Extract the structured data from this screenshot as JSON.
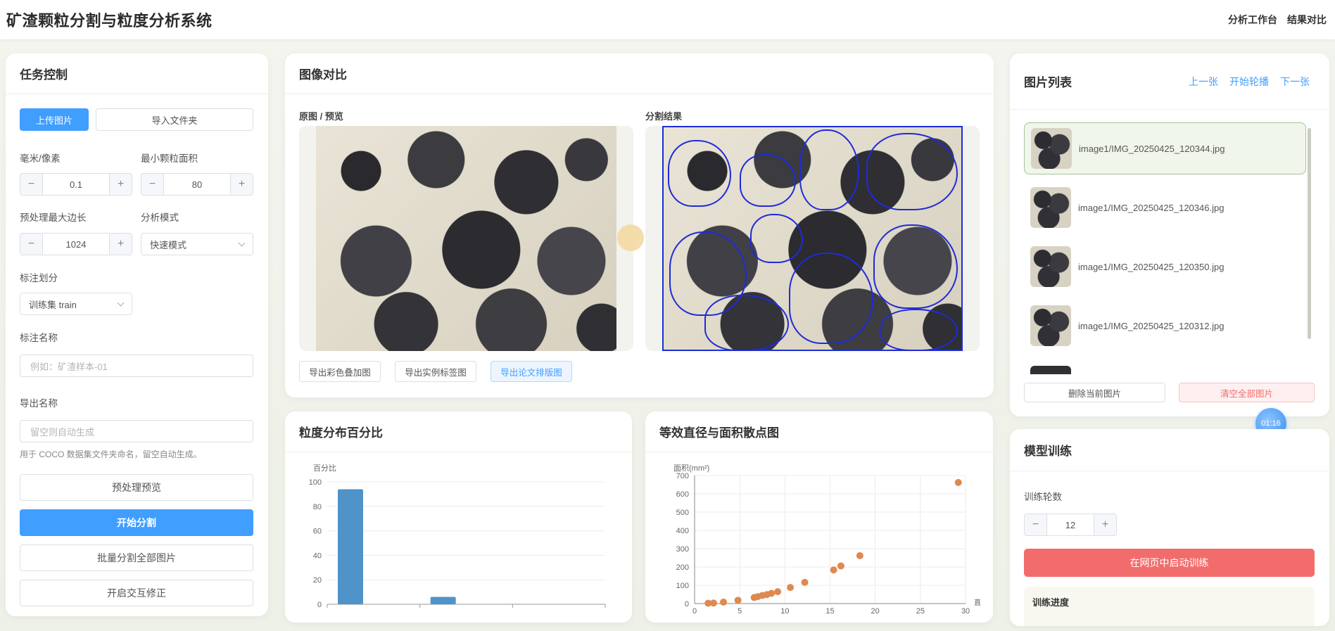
{
  "app": {
    "title": "矿渣颗粒分割与粒度分析系统"
  },
  "topnav": {
    "workbench": "分析工作台",
    "compare": "结果对比"
  },
  "task": {
    "title": "任务控制",
    "upload_label": "上传图片",
    "import_folder_label": "导入文件夹",
    "mm_per_px_label": "毫米/像素",
    "mm_per_px_value": "0.1",
    "min_area_label": "最小颗粒面积",
    "min_area_value": "80",
    "max_edge_label": "预处理最大边长",
    "max_edge_value": "1024",
    "mode_label": "分析模式",
    "mode_value": "快速模式",
    "split_label": "标注划分",
    "split_value": "训练集 train",
    "annot_name_label": "标注名称",
    "annot_name_placeholder": "例如：矿渣样本-01",
    "export_name_label": "导出名称",
    "export_name_placeholder": "留空则自动生成",
    "export_hint": "用于 COCO 数据集文件夹命名，留空自动生成。",
    "preprocess_label": "预处理预览",
    "start_seg_label": "开始分割",
    "batch_seg_label": "批量分割全部图片",
    "interactive_label": "开启交互修正"
  },
  "compare": {
    "title": "图像对比",
    "original_label": "原图 / 预览",
    "result_label": "分割结果",
    "export_overlay_label": "导出彩色叠加图",
    "export_instance_label": "导出实例标签图",
    "export_paper_label": "导出论文排版图"
  },
  "imagelist": {
    "title": "图片列表",
    "prev_label": "上一张",
    "carousel_label": "开始轮播",
    "next_label": "下一张",
    "items": [
      {
        "name": "image1/IMG_20250425_120344.jpg"
      },
      {
        "name": "image1/IMG_20250425_120346.jpg"
      },
      {
        "name": "image1/IMG_20250425_120350.jpg"
      },
      {
        "name": "image1/IMG_20250425_120312.jpg"
      }
    ],
    "delete_current_label": "删除当前图片",
    "clear_all_label": "清空全部图片",
    "timer": "01:16"
  },
  "training": {
    "title": "模型训练",
    "epochs_label": "训练轮数",
    "epochs_value": "12",
    "start_label": "在网页中启动训练",
    "progress_label": "训练进度"
  },
  "dist_chart": {
    "title": "粒度分布百分比",
    "chart_data": {
      "type": "bar",
      "ylabel": "百分比",
      "ylim": [
        0,
        100
      ],
      "yticks": [
        "0",
        "20",
        "40",
        "60",
        "80",
        "100"
      ],
      "values": [
        94,
        6,
        0
      ]
    }
  },
  "scatter_chart": {
    "title": "等效直径与面积散点图",
    "chart_data": {
      "type": "scatter",
      "ylabel": "面积(mm²)",
      "xlabel": "直",
      "xlim": [
        0,
        30
      ],
      "ylim": [
        0,
        700
      ],
      "xticks": [
        "0",
        "5",
        "10",
        "15",
        "20",
        "25",
        "30"
      ],
      "yticks": [
        "0",
        "100",
        "200",
        "300",
        "400",
        "500",
        "600",
        "700"
      ],
      "points": [
        [
          1.5,
          2
        ],
        [
          2.1,
          3
        ],
        [
          3.2,
          8
        ],
        [
          4.8,
          18
        ],
        [
          6.6,
          33
        ],
        [
          7.0,
          38
        ],
        [
          7.5,
          44
        ],
        [
          8.0,
          49
        ],
        [
          8.5,
          56
        ],
        [
          9.2,
          65
        ],
        [
          10.6,
          88
        ],
        [
          12.2,
          116
        ],
        [
          15.4,
          184
        ],
        [
          16.2,
          206
        ],
        [
          18.3,
          262
        ],
        [
          29.2,
          662
        ]
      ],
      "color": "#de8a4f"
    }
  },
  "colors": {
    "primary": "#409eff",
    "danger": "#f36c6c",
    "seg_outline": "#1f2bd9",
    "bar": "#4f93c9"
  }
}
